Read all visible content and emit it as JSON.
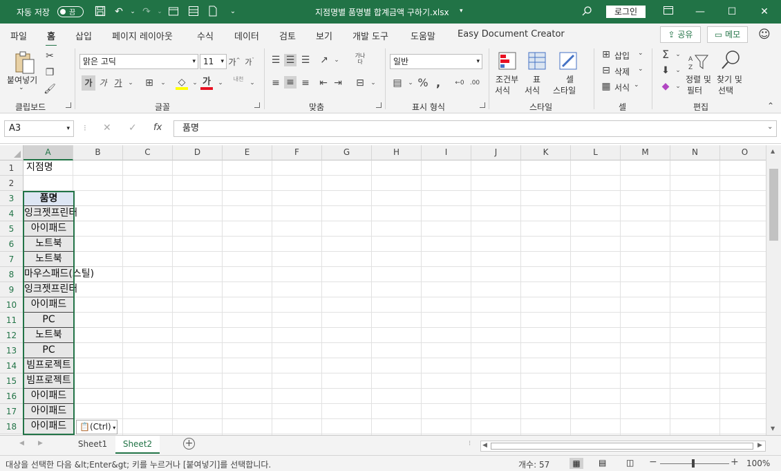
{
  "titlebar": {
    "autosave_label": "자동 저장",
    "autosave_state": "끔",
    "filename": "지점명별 품명별 합계금액 구하기.xlsx",
    "login_label": "로그인",
    "accent": "#217346"
  },
  "ribbon_tabs": [
    "파일",
    "홈",
    "삽입",
    "페이지 레이아웃",
    "수식",
    "데이터",
    "검토",
    "보기",
    "개발 도구",
    "도움말",
    "Easy Document Creator"
  ],
  "active_tab": "홈",
  "share_label": "공유",
  "memo_label": "메모",
  "ribbon": {
    "clipboard": {
      "paste": "붙여넣기",
      "group": "클립보드"
    },
    "font": {
      "name": "맑은 고딕",
      "size": "11",
      "bold": "가",
      "italic": "가",
      "underline": "가",
      "group": "글꼴",
      "phonetic": "내천"
    },
    "alignment": {
      "group": "맞춤",
      "wrap": "가나\n다"
    },
    "number": {
      "format": "일반",
      "group": "표시 형식"
    },
    "styles": {
      "conditional": [
        "조건부",
        "서식"
      ],
      "table": [
        "표",
        "서식"
      ],
      "cell": [
        "셀",
        "스타일"
      ],
      "group": "스타일"
    },
    "cells": {
      "insert": "삽입",
      "delete": "삭제",
      "format": "서식",
      "group": "셀"
    },
    "editing": {
      "sort": [
        "정렬 및",
        "필터"
      ],
      "find": [
        "찾기 및",
        "선택"
      ],
      "group": "편집"
    }
  },
  "namebox": "A3",
  "formula": "품명",
  "columns": [
    "A",
    "B",
    "C",
    "D",
    "E",
    "F",
    "G",
    "H",
    "I",
    "J",
    "K",
    "L",
    "M",
    "N",
    "O"
  ],
  "rows": [
    {
      "n": "1",
      "a": "지점명"
    },
    {
      "n": "2",
      "a": ""
    },
    {
      "n": "3",
      "a": "품명"
    },
    {
      "n": "4",
      "a": "잉크젯프린터"
    },
    {
      "n": "5",
      "a": "아이패드"
    },
    {
      "n": "6",
      "a": "노트북"
    },
    {
      "n": "7",
      "a": "노트북"
    },
    {
      "n": "8",
      "a": "마우스패드(스틸)"
    },
    {
      "n": "9",
      "a": "잉크젯프린터"
    },
    {
      "n": "10",
      "a": "아이패드"
    },
    {
      "n": "11",
      "a": "PC"
    },
    {
      "n": "12",
      "a": "노트북"
    },
    {
      "n": "13",
      "a": "PC"
    },
    {
      "n": "14",
      "a": "빔프로젝트"
    },
    {
      "n": "15",
      "a": "빔프로젝트"
    },
    {
      "n": "16",
      "a": "아이패드"
    },
    {
      "n": "17",
      "a": "아이패드"
    },
    {
      "n": "18",
      "a": "아이패드"
    }
  ],
  "paste_options": "(Ctrl)",
  "sheets": [
    "Sheet1",
    "Sheet2"
  ],
  "active_sheet": "Sheet2",
  "status": {
    "message": "대상을 선택한 다음 &lt;Enter&gt; 키를 누르거나 [붙여넣기]를 선택합니다.",
    "count": "개수: 57",
    "zoom": "100%"
  }
}
